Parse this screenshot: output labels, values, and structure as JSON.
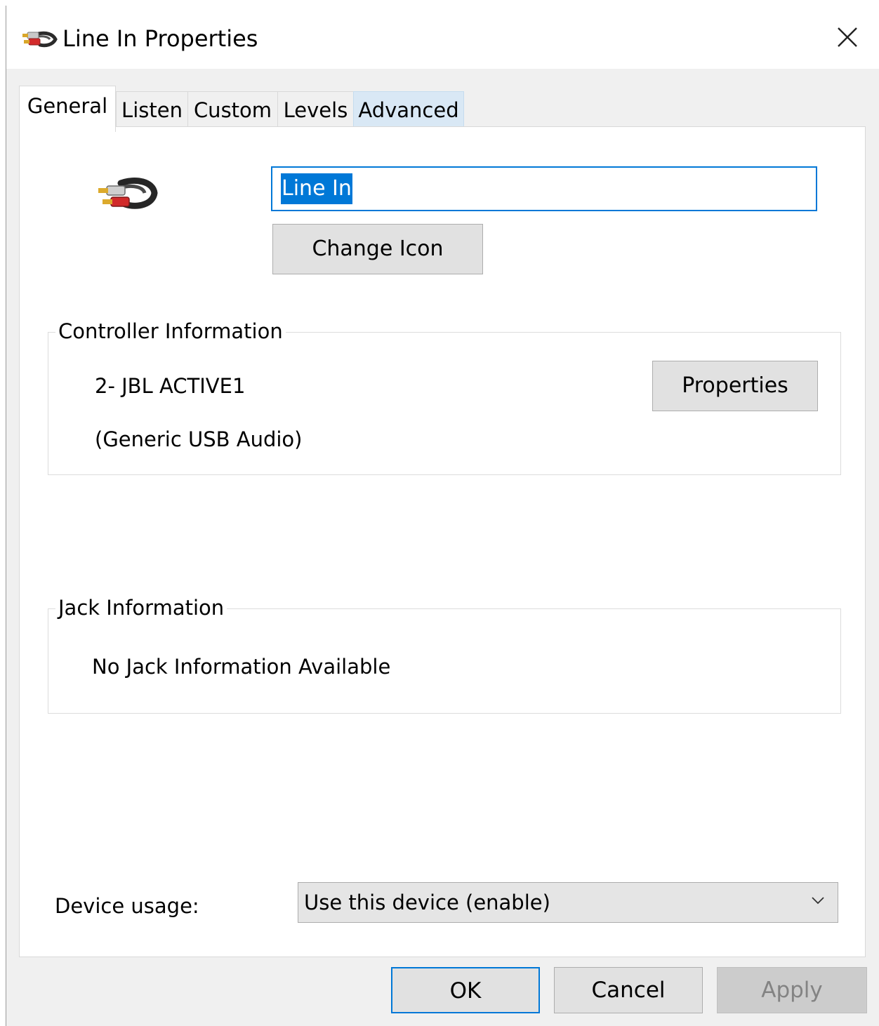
{
  "window": {
    "title": "Line In Properties",
    "icons": {
      "title": "rca-cable-icon",
      "close": "close-icon"
    }
  },
  "tabs": [
    {
      "label": "General",
      "active": true
    },
    {
      "label": "Listen",
      "active": false
    },
    {
      "label": "Custom",
      "active": false
    },
    {
      "label": "Levels",
      "active": false
    },
    {
      "label": "Advanced",
      "active": false
    }
  ],
  "general": {
    "device_name": "Line In",
    "change_icon_label": "Change Icon",
    "controller": {
      "legend": "Controller Information",
      "name": "2- JBL ACTIVE1",
      "driver": "(Generic USB Audio)",
      "properties_label": "Properties"
    },
    "jack": {
      "legend": "Jack Information",
      "message": "No Jack Information Available"
    },
    "device_usage": {
      "label": "Device usage:",
      "selected": "Use this device (enable)"
    }
  },
  "footer": {
    "ok_label": "OK",
    "cancel_label": "Cancel",
    "apply_label": "Apply"
  },
  "colors": {
    "accent": "#0078d7",
    "dialog_bg": "#f0f0f0",
    "disabled_text": "#838383"
  }
}
